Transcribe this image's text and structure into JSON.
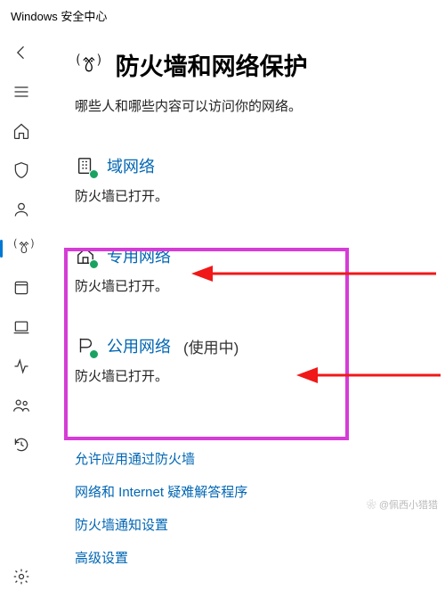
{
  "window_title": "Windows 安全中心",
  "page": {
    "title": "防火墙和网络保护",
    "subtitle": "哪些人和哪些内容可以访问你的网络。"
  },
  "networks": {
    "domain": {
      "title": "域网络",
      "status": "防火墙已打开。"
    },
    "private": {
      "title": "专用网络",
      "status": "防火墙已打开。"
    },
    "public": {
      "title": "公用网络",
      "in_use": "(使用中)",
      "status": "防火墙已打开。"
    }
  },
  "links": {
    "allow_app": "允许应用通过防火墙",
    "troubleshoot": "网络和 Internet 疑难解答程序",
    "notifications": "防火墙通知设置",
    "advanced": "高级设置"
  },
  "watermark": "❀ @佩西小猎猎"
}
